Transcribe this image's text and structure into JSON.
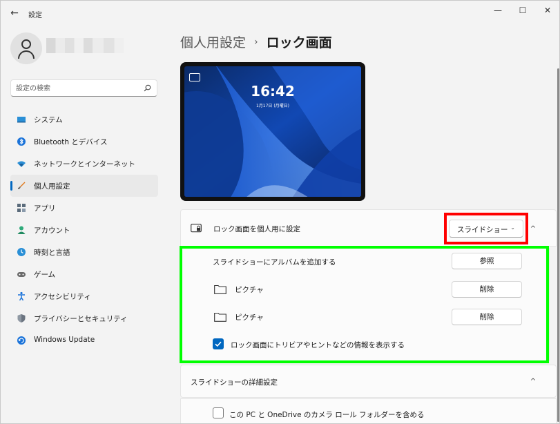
{
  "window": {
    "app_title": "設定",
    "back_glyph": "←",
    "minimize_glyph": "—",
    "maximize_glyph": "☐",
    "close_glyph": "✕"
  },
  "search": {
    "placeholder": "設定の検索"
  },
  "sidebar": {
    "items": [
      {
        "label": "システム",
        "icon": "system-icon",
        "active": false
      },
      {
        "label": "Bluetooth とデバイス",
        "icon": "bluetooth-icon",
        "active": false
      },
      {
        "label": "ネットワークとインターネット",
        "icon": "wifi-icon",
        "active": false
      },
      {
        "label": "個人用設定",
        "icon": "brush-icon",
        "active": true
      },
      {
        "label": "アプリ",
        "icon": "apps-icon",
        "active": false
      },
      {
        "label": "アカウント",
        "icon": "account-icon",
        "active": false
      },
      {
        "label": "時刻と言語",
        "icon": "time-language-icon",
        "active": false
      },
      {
        "label": "ゲーム",
        "icon": "gamepad-icon",
        "active": false
      },
      {
        "label": "アクセシビリティ",
        "icon": "accessibility-icon",
        "active": false
      },
      {
        "label": "プライバシーとセキュリティ",
        "icon": "shield-icon",
        "active": false
      },
      {
        "label": "Windows Update",
        "icon": "windows-update-icon",
        "active": false
      }
    ]
  },
  "breadcrumb": {
    "parent": "個人用設定",
    "separator": "›",
    "current": "ロック画面"
  },
  "preview": {
    "time": "16:42",
    "date": "1月17日 (月曜日)"
  },
  "lock_screen": {
    "label": "ロック画面を個人用に設定",
    "dropdown_value": "スライドショー",
    "dropdown_chevron": "⌄",
    "collapse_chevron": "^"
  },
  "slideshow": {
    "add_album_label": "スライドショーにアルバムを追加する",
    "browse_button": "参照",
    "folders": [
      {
        "name": "ピクチャ",
        "remove_button": "削除"
      },
      {
        "name": "ピクチャ",
        "remove_button": "削除"
      }
    ],
    "trivia_label": "ロック画面にトリビアやヒントなどの情報を表示する",
    "trivia_checked": true
  },
  "advanced": {
    "label": "スライドショーの詳細設定",
    "chevron": "^",
    "onedrive_label": "この PC と OneDrive のカメラ ロール フォルダーを含める",
    "onedrive_checked": false
  },
  "colors": {
    "accent": "#0067c0",
    "highlight_red": "#ff0000",
    "highlight_green": "#00ff00"
  }
}
